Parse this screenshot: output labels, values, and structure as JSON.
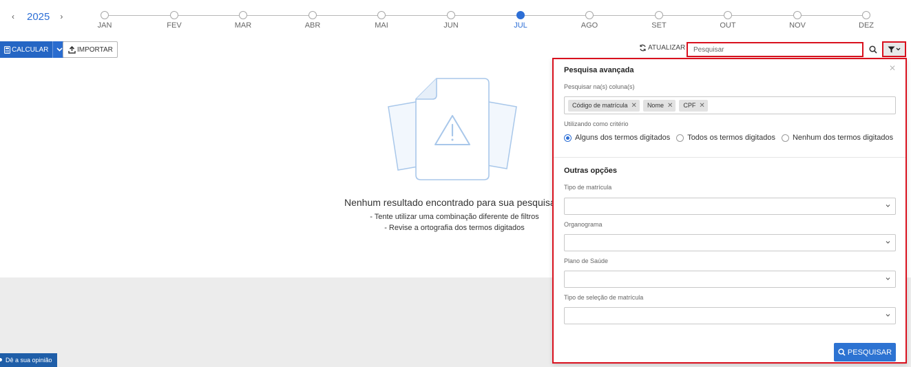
{
  "timeline": {
    "year": "2025",
    "prev_icon": "chevron-left-icon",
    "next_icon": "chevron-right-icon",
    "months": [
      "JAN",
      "FEV",
      "MAR",
      "ABR",
      "MAI",
      "JUN",
      "JUL",
      "AGO",
      "SET",
      "OUT",
      "NOV",
      "DEZ"
    ],
    "active_month": "JUL",
    "accent_color": "#2d6fd6"
  },
  "toolbar": {
    "calcular_label": "CALCULAR",
    "calcular_icon": "calculator-icon",
    "importar_label": "IMPORTAR",
    "importar_icon": "upload-icon",
    "atualizar_label": "ATUALIZAR",
    "atualizar_icon": "refresh-icon",
    "search_placeholder": "Pesquisar",
    "search_icon": "search-icon",
    "filter_icon": "filter-icon",
    "highlight_color": "#d9101d"
  },
  "empty_state": {
    "title": "Nenhum resultado encontrado para sua pesquisa",
    "hint_1": "- Tente utilizar uma combinação diferente de filtros",
    "hint_2": "- Revise a ortografia dos termos digitados"
  },
  "advanced_search": {
    "title": "Pesquisa avançada",
    "columns_label": "Pesquisar na(s) coluna(s)",
    "chips": [
      "Código de matrícula",
      "Nome",
      "CPF"
    ],
    "criteria_label": "Utilizando como critério",
    "criteria_options": [
      "Alguns dos termos digitados",
      "Todos os termos digitados",
      "Nenhum dos termos digitados"
    ],
    "criteria_selected": "Alguns dos termos digitados",
    "other_options_title": "Outras opções",
    "fields": [
      {
        "label": "Tipo de matrícula",
        "value": ""
      },
      {
        "label": "Organograma",
        "value": ""
      },
      {
        "label": "Plano de Saúde",
        "value": ""
      },
      {
        "label": "Tipo de seleção de matrícula",
        "value": ""
      }
    ],
    "submit_label": "PESQUISAR"
  },
  "feedback": {
    "label": "Dê a sua opinião"
  }
}
